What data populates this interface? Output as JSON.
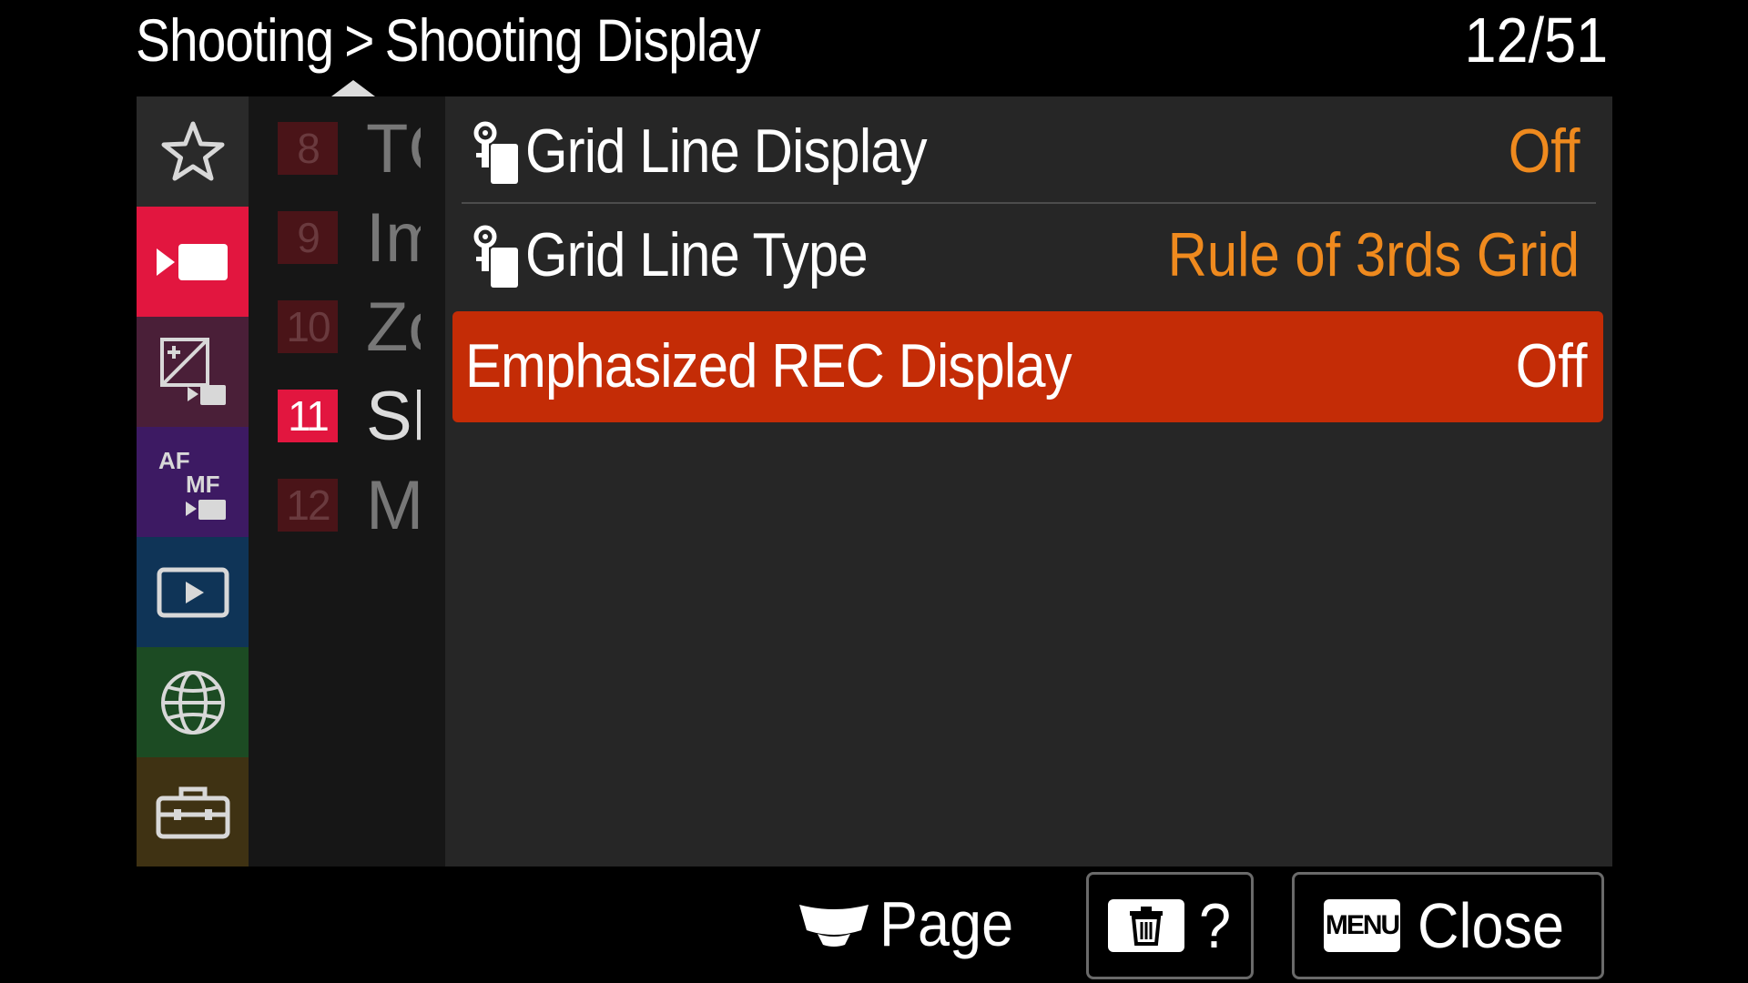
{
  "header": {
    "breadcrumb_parent": "Shooting",
    "breadcrumb_separator": ">",
    "breadcrumb_current": "Shooting Display",
    "page_indicator": "12/51"
  },
  "sidebar": {
    "categories": [
      {
        "name": "My Menu",
        "icon": "star-icon",
        "color": "#2a2a2a"
      },
      {
        "name": "Shooting",
        "icon": "movie-camera-icon",
        "color": "#e2163f"
      },
      {
        "name": "Exposure/Color",
        "icon": "exposure-icon",
        "color": "#4a1f38"
      },
      {
        "name": "Focus",
        "icon": "af-mf-icon",
        "color": "#3d1a63"
      },
      {
        "name": "Playback",
        "icon": "play-icon",
        "color": "#0f3457"
      },
      {
        "name": "Network",
        "icon": "globe-icon",
        "color": "#1c4b23"
      },
      {
        "name": "Setup",
        "icon": "toolbox-icon",
        "color": "#3f3213"
      }
    ]
  },
  "page_list": [
    {
      "number": "8",
      "text": "TC",
      "active": false
    },
    {
      "number": "9",
      "text": "Im",
      "active": false
    },
    {
      "number": "10",
      "text": "Zo",
      "active": false
    },
    {
      "number": "11",
      "text": "Sh",
      "active": true
    },
    {
      "number": "12",
      "text": "M",
      "active": false
    }
  ],
  "menu_items": [
    {
      "label": "Grid Line Display",
      "value": "Off",
      "icon": "custom-key-icon"
    },
    {
      "label": "Grid Line Type",
      "value": "Rule of 3rds Grid",
      "icon": "custom-key-icon"
    },
    {
      "label": "Emphasized REC Display",
      "value": "Off",
      "selected": true
    }
  ],
  "footer": {
    "page_label": "Page",
    "help_label": "?",
    "menu_key_label": "MENU",
    "close_label": "Close"
  },
  "colors": {
    "accent_selected": "#c42c06",
    "value_orange": "#ef8a1e",
    "tab_active": "#e2163f"
  }
}
